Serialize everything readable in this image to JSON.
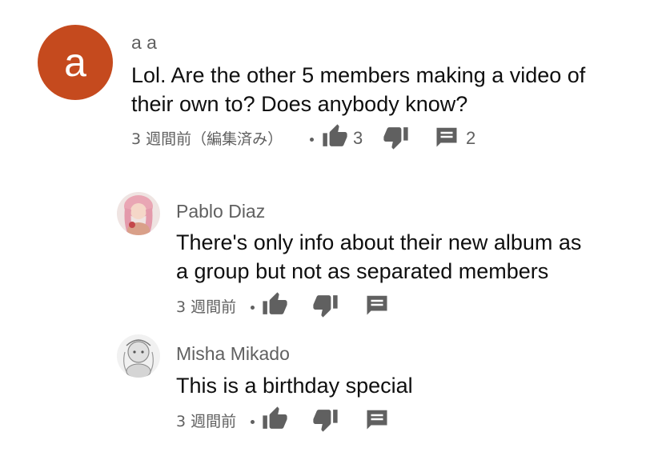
{
  "comments": [
    {
      "avatar_letter": "a",
      "avatar_color": "#c54a1e",
      "author": "a a",
      "text_lines": [
        "Lol. Are the other 5 members making a video of",
        "their own to? Does anybody know?"
      ],
      "time": "3 週間前（編集済み）",
      "likes": "3",
      "replies": "2"
    },
    {
      "author": "Pablo Diaz",
      "text_lines": [
        "There's only info about their new album as",
        "a group but not as separated members"
      ],
      "time": "3 週間前"
    },
    {
      "author": "Misha Mikado",
      "text_lines": [
        "This is a birthday special"
      ],
      "time": "3 週間前"
    }
  ],
  "icons": {
    "like": "thumbs-up-icon",
    "dislike": "thumbs-down-icon",
    "reply": "reply-icon"
  },
  "colors": {
    "text": "#0f0f0f",
    "secondary": "#606060",
    "icon": "#606060"
  }
}
